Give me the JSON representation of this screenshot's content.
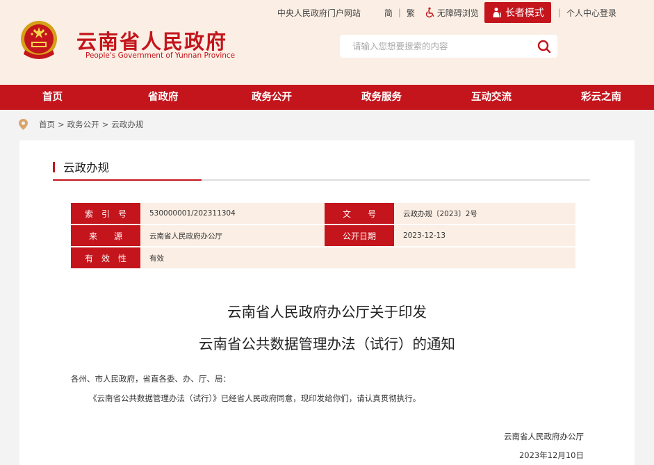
{
  "topbar": {
    "portal_link": "中央人民政府门户网站",
    "simplified": "简",
    "traditional": "繁",
    "accessibility": "无障碍浏览",
    "elder_mode": "长者模式",
    "user_center": "个人中心登录",
    "separator": "|"
  },
  "site": {
    "title": "云南省人民政府",
    "subtitle": "People's Government of Yunnan Province"
  },
  "search": {
    "placeholder": "请输入您想要搜索的内容"
  },
  "nav": [
    "首页",
    "省政府",
    "政务公开",
    "政务服务",
    "互动交流",
    "彩云之南"
  ],
  "breadcrumb": {
    "items": [
      "首页",
      "政务公开",
      "云政办规"
    ],
    "separator": ">"
  },
  "section": {
    "title": "云政办规"
  },
  "meta": [
    [
      {
        "label": "索　引　号",
        "value": "530000001/202311304"
      },
      {
        "label": "文　　号",
        "value": "云政办规〔2023〕2号"
      }
    ],
    [
      {
        "label": "来　　源",
        "value": "云南省人民政府办公厅"
      },
      {
        "label": "公开日期",
        "value": "2023-12-13"
      }
    ],
    [
      {
        "label": "有　效　性",
        "value": "有效"
      }
    ]
  ],
  "document": {
    "title_line1": "云南省人民政府办公厅关于印发",
    "title_line2": "云南省公共数据管理办法（试行）的通知",
    "salutation": "各州、市人民政府，省直各委、办、厅、局：",
    "body": "《云南省公共数据管理办法（试行）》已经省人民政府同意，现印发给你们，请认真贯彻执行。",
    "issuer": "云南省人民政府办公厅",
    "date": "2023年12月10日"
  },
  "colors": {
    "brand_red": "#c4151c",
    "header_bg": "#fbeee4",
    "page_bg": "#f3f3f3"
  }
}
